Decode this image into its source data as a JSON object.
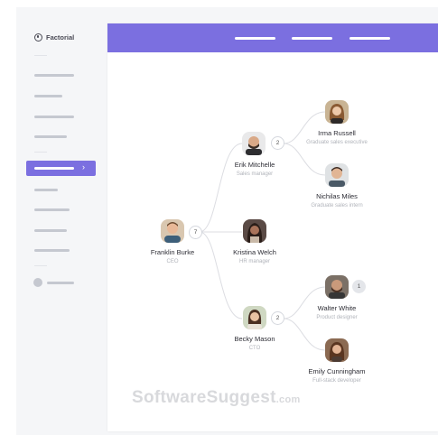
{
  "app": {
    "name": "Factorial"
  },
  "colors": {
    "accent": "#7b6fe0",
    "sidebar": "#f5f6f8",
    "link": "#dcdde2"
  },
  "sidebar": {
    "active_chevron": "›"
  },
  "org": {
    "ceo": {
      "name": "Franklin Burke",
      "role": "CEO",
      "reports": "7"
    },
    "erik": {
      "name": "Erik Mitchelle",
      "role": "Sales manager",
      "reports": "2"
    },
    "kristina": {
      "name": "Kristina Welch",
      "role": "HR manager"
    },
    "becky": {
      "name": "Becky Mason",
      "role": "CTO",
      "reports": "2"
    },
    "irma": {
      "name": "Irma Russell",
      "role": "Graduate sales executive"
    },
    "nichilas": {
      "name": "Nichilas Miles",
      "role": "Graduate sales intern"
    },
    "walter": {
      "name": "Walter White",
      "role": "Product designer",
      "reports": "1"
    },
    "emily": {
      "name": "Emily Cunningham",
      "role": "Full-stack developer"
    }
  },
  "watermark": {
    "brand": "SoftwareSuggest",
    "domain": ".com"
  }
}
